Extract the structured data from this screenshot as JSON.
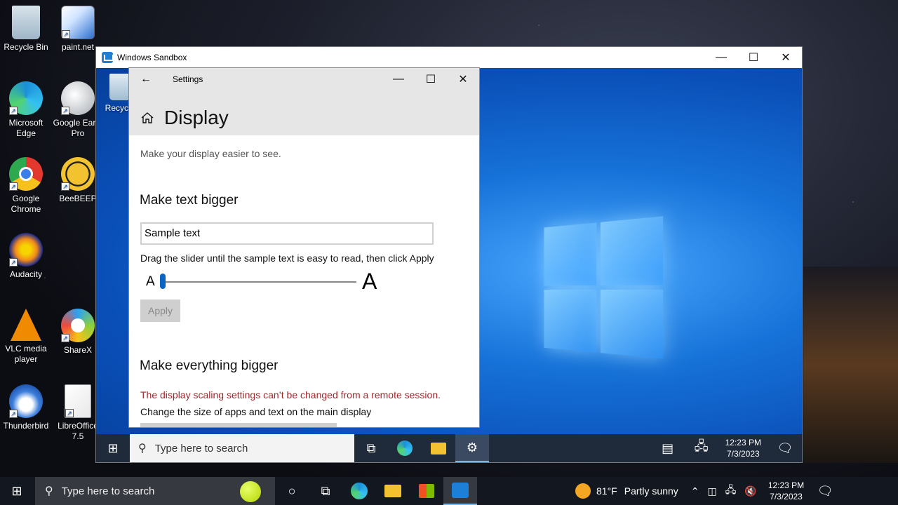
{
  "desktop": {
    "icons": [
      {
        "label": "Recycle Bin"
      },
      {
        "label": "paint.net"
      },
      {
        "label": "Microsoft Edge"
      },
      {
        "label": "Google Earth Pro"
      },
      {
        "label": "Google Chrome"
      },
      {
        "label": "BeeBEEP"
      },
      {
        "label": "Audacity"
      },
      {
        "label": "VLC media player"
      },
      {
        "label": "ShareX"
      },
      {
        "label": "Thunderbird"
      },
      {
        "label": "LibreOffice 7.5"
      }
    ],
    "icon_colors": {
      "recycle": "#9fb6c8",
      "paint": "#2b6fcf",
      "edge": "#1b8fd8",
      "earth": "#c0c4c8",
      "chrome": "#e3382e",
      "beebeep": "#f2c230",
      "audacity": "#f28a1d",
      "vlc": "#f08a00",
      "sharex": "#2ea1f2",
      "thunderbird": "#3d7fdc",
      "libreoffice": "#e8e8e8"
    }
  },
  "sandbox": {
    "title": "Windows Sandbox",
    "recycle_label": "Recycle",
    "taskbar": {
      "search_placeholder": "Type here to search",
      "time": "12:23 PM",
      "date": "7/3/2023"
    }
  },
  "settings": {
    "title": "Settings",
    "heading": "Display",
    "description": "Make your display easier to see.",
    "text_bigger_heading": "Make text bigger",
    "sample_text": "Sample text",
    "instruction": "Drag the slider until the sample text is easy to read, then click Apply",
    "slider_min_label": "A",
    "slider_max_label": "A",
    "slider_value_fraction": 0.0,
    "apply_label": "Apply",
    "everything_bigger_heading": "Make everything bigger",
    "warning": "The display scaling settings can’t be changed from a remote session.",
    "change_size_label": "Change the size of apps and text on the main display"
  },
  "host_taskbar": {
    "search_placeholder": "Type here to search",
    "weather_temp": "81°F",
    "weather_desc": "Partly sunny",
    "time": "12:23 PM",
    "date": "7/3/2023"
  }
}
